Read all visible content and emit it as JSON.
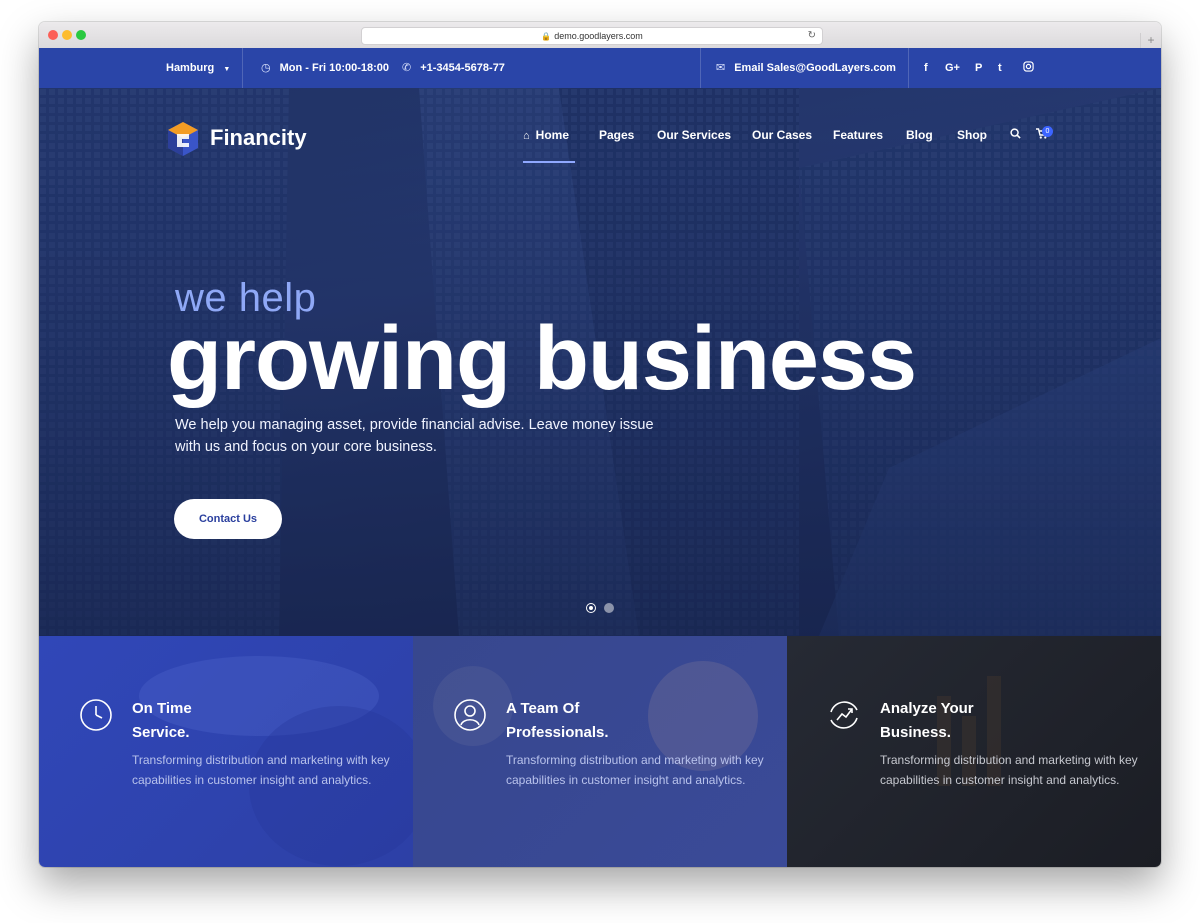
{
  "browser": {
    "url": "demo.goodlayers.com"
  },
  "topbar": {
    "location": "Hamburg",
    "hours": "Mon - Fri 10:00-18:00",
    "phone": "+1-3454-5678-77",
    "email": "Email Sales@GoodLayers.com",
    "social": [
      "f",
      "G+",
      "P",
      "t",
      "ig"
    ]
  },
  "header": {
    "logo_text": "Financity",
    "nav": [
      "Home",
      "Pages",
      "Our Services",
      "Our Cases",
      "Features",
      "Blog",
      "Shop"
    ],
    "cart_count": "0"
  },
  "hero": {
    "tagline_small": "we help",
    "tagline_big": "growing business",
    "text_line1": "We help you managing asset, provide financial advise. Leave money issue",
    "text_line2": "with us and focus on your core business.",
    "cta": "Contact Us"
  },
  "features": [
    {
      "title_line1": "On Time",
      "title_line2": "Service.",
      "text": "Transforming distribution and marketing with key capabilities in customer insight and analytics."
    },
    {
      "title_line1": "A Team Of",
      "title_line2": "Professionals.",
      "text": "Transforming distribution and marketing with key capabilities in customer insight and analytics."
    },
    {
      "title_line1": "Analyze Your",
      "title_line2": "Business.",
      "text": "Transforming distribution and marketing with key capabilities in customer insight and analytics."
    }
  ],
  "colors": {
    "brand_blue": "#2a45a8",
    "accent": "#3c64ff"
  }
}
